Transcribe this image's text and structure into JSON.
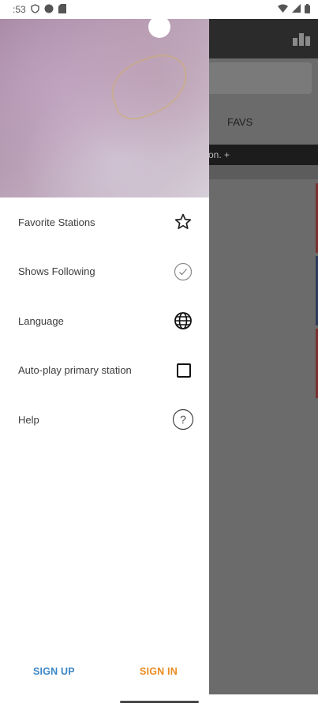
{
  "status_bar": {
    "time": ":53"
  },
  "background_app": {
    "tab_favs": "FAVS",
    "banner_text": "on. +"
  },
  "drawer": {
    "menu": [
      {
        "label": "Favorite Stations",
        "icon": "star-outline-icon"
      },
      {
        "label": "Shows Following",
        "icon": "check-circle-icon"
      },
      {
        "label": "Language",
        "icon": "globe-icon"
      },
      {
        "label": "Auto-play primary station",
        "icon": "checkbox-icon"
      },
      {
        "label": "Help",
        "icon": "help-circle-icon"
      }
    ],
    "footer": {
      "sign_up": "SIGN UP",
      "sign_in": "SIGN IN"
    }
  },
  "colors": {
    "sign_up": "#3b86c7",
    "sign_in": "#e98a1d",
    "scrim": "#6b6b6b"
  }
}
